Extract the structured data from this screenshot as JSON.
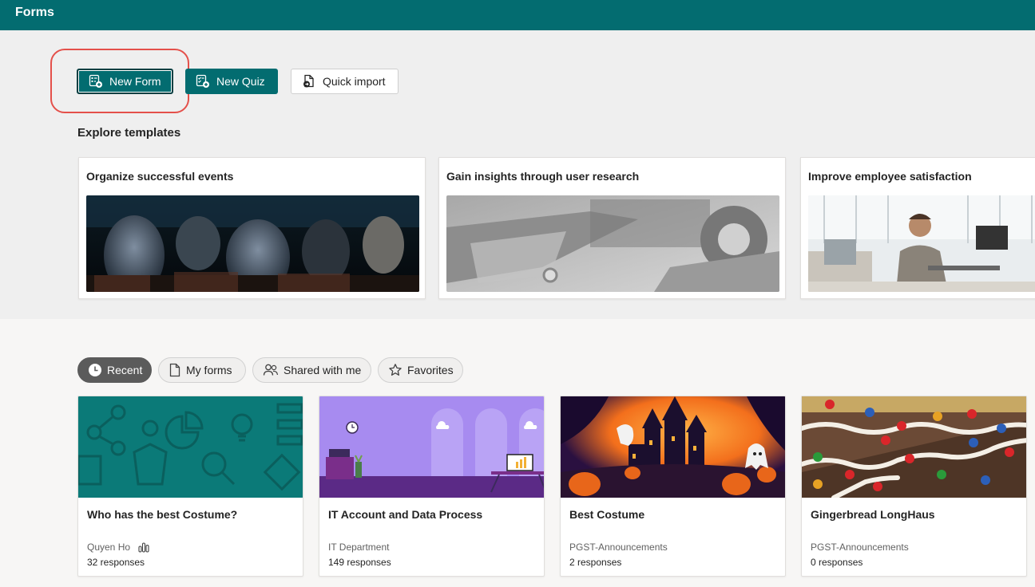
{
  "header": {
    "app_title": "Forms"
  },
  "actions": {
    "new_form": "New Form",
    "new_quiz": "New Quiz",
    "quick_import": "Quick import"
  },
  "templates": {
    "section_title": "Explore templates",
    "items": [
      {
        "title": "Organize successful events"
      },
      {
        "title": "Gain insights through user research"
      },
      {
        "title": "Improve employee satisfaction"
      }
    ]
  },
  "filters": [
    {
      "label": "Recent",
      "active": true
    },
    {
      "label": "My forms",
      "active": false
    },
    {
      "label": "Shared with me",
      "active": false
    },
    {
      "label": "Favorites",
      "active": false
    }
  ],
  "forms": [
    {
      "title": "Who has the best Costume?",
      "owner": "Quyen Ho",
      "responses": "32 responses",
      "has_chart_icon": true
    },
    {
      "title": "IT Account and Data Process",
      "owner": "IT Department",
      "responses": "149 responses"
    },
    {
      "title": "Best Costume",
      "owner": "PGST-Announcements",
      "responses": "2 responses"
    },
    {
      "title": "Gingerbread LongHaus",
      "owner": "PGST-Announcements",
      "responses": "0 responses"
    }
  ],
  "colors": {
    "brand": "#036c70",
    "highlight": "#e4504a"
  }
}
